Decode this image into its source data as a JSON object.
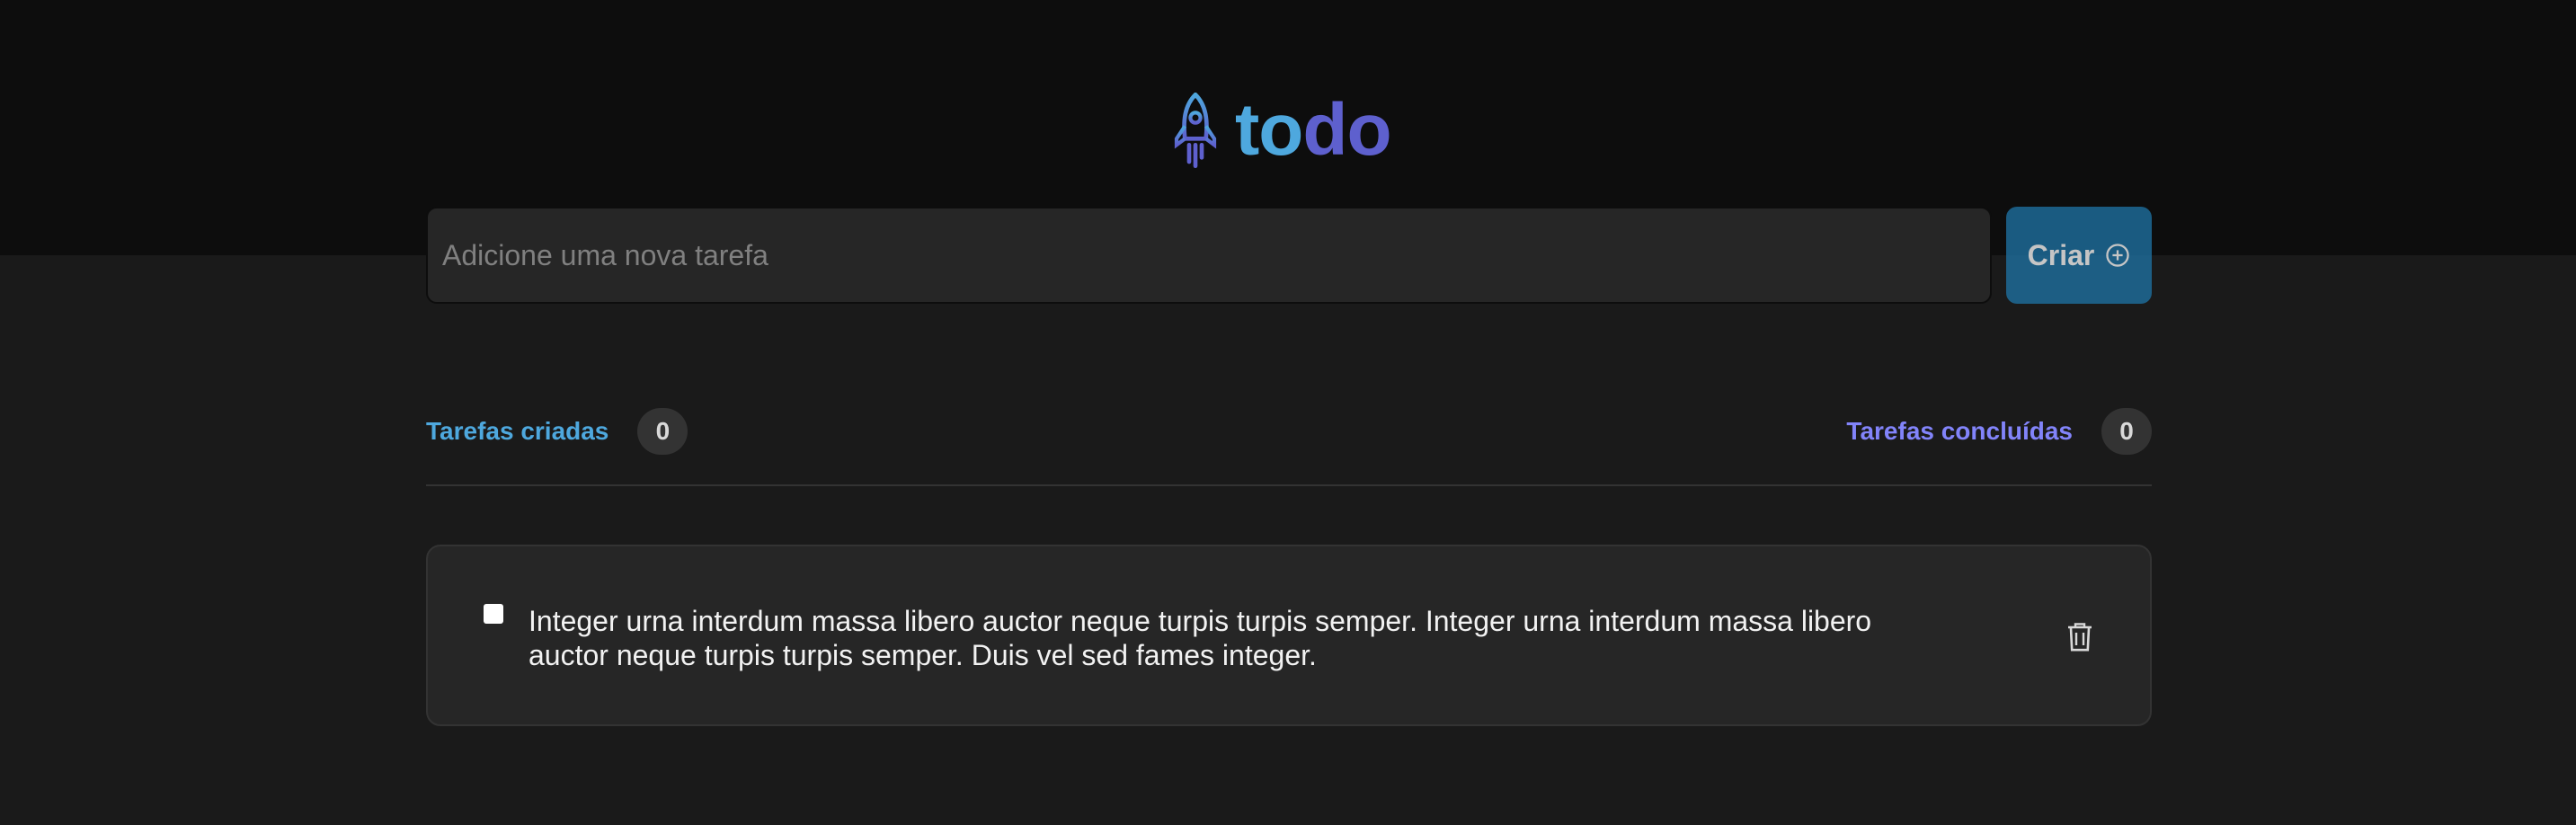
{
  "header": {
    "logo_text_part1": "to",
    "logo_text_part2": "do"
  },
  "new_task": {
    "placeholder": "Adicione uma nova tarefa",
    "value": "",
    "create_label": "Criar"
  },
  "counters": {
    "created_label": "Tarefas criadas",
    "created_count": "0",
    "done_label": "Tarefas concluídas",
    "done_count": "0"
  },
  "tasks": [
    {
      "text": "Integer urna interdum massa libero auctor neque turpis turpis semper. Integer urna interdum massa libero auctor neque turpis turpis semper. Duis vel sed fames integer.",
      "completed": false
    }
  ],
  "icons": {
    "logo": "rocket-icon",
    "create": "plus-circle-icon",
    "delete": "trash-icon"
  },
  "colors": {
    "brand_blue": "#4ea8de",
    "brand_purple": "#5e60ce",
    "purple_light": "#8284fa",
    "button_blue": "#1e6f9f",
    "header_bg": "#0d0d0d",
    "page_bg": "#1a1a1a",
    "card_bg": "#262626"
  }
}
